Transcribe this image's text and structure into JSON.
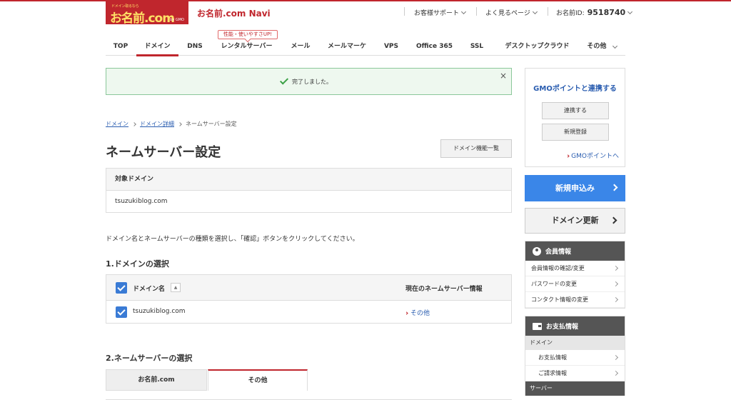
{
  "header": {
    "logo_tagline": "ドメイン取るなら",
    "logo_text": "お名前.com",
    "logo_sub": "by GMO",
    "app_title": "お名前.com Navi",
    "support": "お客様サポート",
    "faq": "よく見るページ",
    "user_id_label": "お名前ID:",
    "user_id_value": "9518740"
  },
  "nav": {
    "promo": "性能・使いやすさUP!",
    "tabs": [
      "TOP",
      "ドメイン",
      "DNS",
      "レンタルサーバー",
      "メール",
      "メールマーケ",
      "VPS",
      "Office 365",
      "SSL",
      "デスクトップクラウド",
      "その他"
    ],
    "active_tab": "ドメイン"
  },
  "alert": {
    "message": "完了しました。",
    "close": "×"
  },
  "breadcrumb": [
    "ドメイン",
    "ドメイン詳細",
    "ネームサーバー設定"
  ],
  "page": {
    "title": "ネームサーバー設定",
    "function_list_button": "ドメイン機能一覧",
    "target_head": "対象ドメイン",
    "target_value": "tsuzukiblog.com",
    "instruction": "ドメイン名とネームサーバーの種類を選択し、「確認」ボタンをクリックしてください。",
    "section1": "1.ドメインの選択",
    "col_domain": "ドメイン名",
    "col_ns": "現在のネームサーバー情報",
    "sort": "▲",
    "row_domain": "tsuzukiblog.com",
    "row_ns": "その他",
    "section2": "2.ネームサーバーの選択",
    "ns_tab_onamae": "お名前.com",
    "ns_tab_other": "その他"
  },
  "sidebar": {
    "gmo_title": "GMOポイントと連携する",
    "link_button": "連携する",
    "register_button": "新規登録",
    "gmo_link": "GMOポイントへ",
    "new_apply": "新規申込み",
    "domain_renew": "ドメイン更新",
    "member_head": "会員情報",
    "member_items": [
      "会員情報の確認/変更",
      "パスワードの変更",
      "コンタクト情報の変更"
    ],
    "payment_head": "お支払情報",
    "payment_sub_domain": "ドメイン",
    "payment_items": [
      "お支払情報",
      "ご請求情報"
    ],
    "payment_sub_server": "サーバー"
  }
}
